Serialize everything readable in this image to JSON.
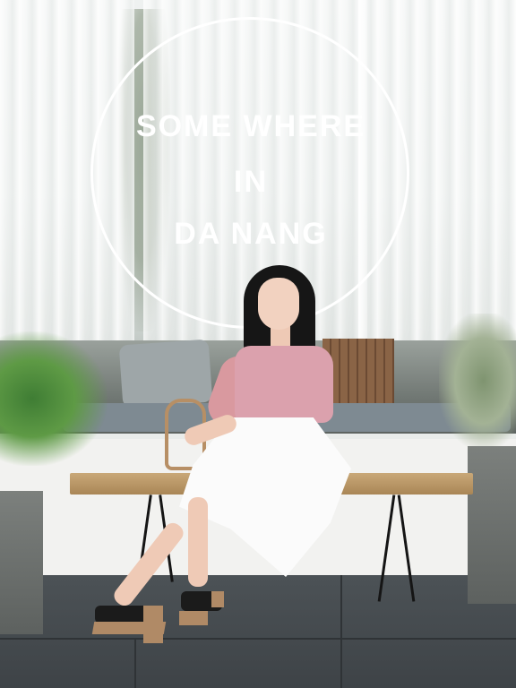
{
  "sign": {
    "line1": "SOME WHERE",
    "line2": "IN",
    "line3": "DA NANG"
  },
  "colors": {
    "sign_text": "#ffffff",
    "blouse": "#dba1ad",
    "skirt": "#fbfbfb",
    "bench": "#b8966a",
    "floor": "#474c50"
  }
}
